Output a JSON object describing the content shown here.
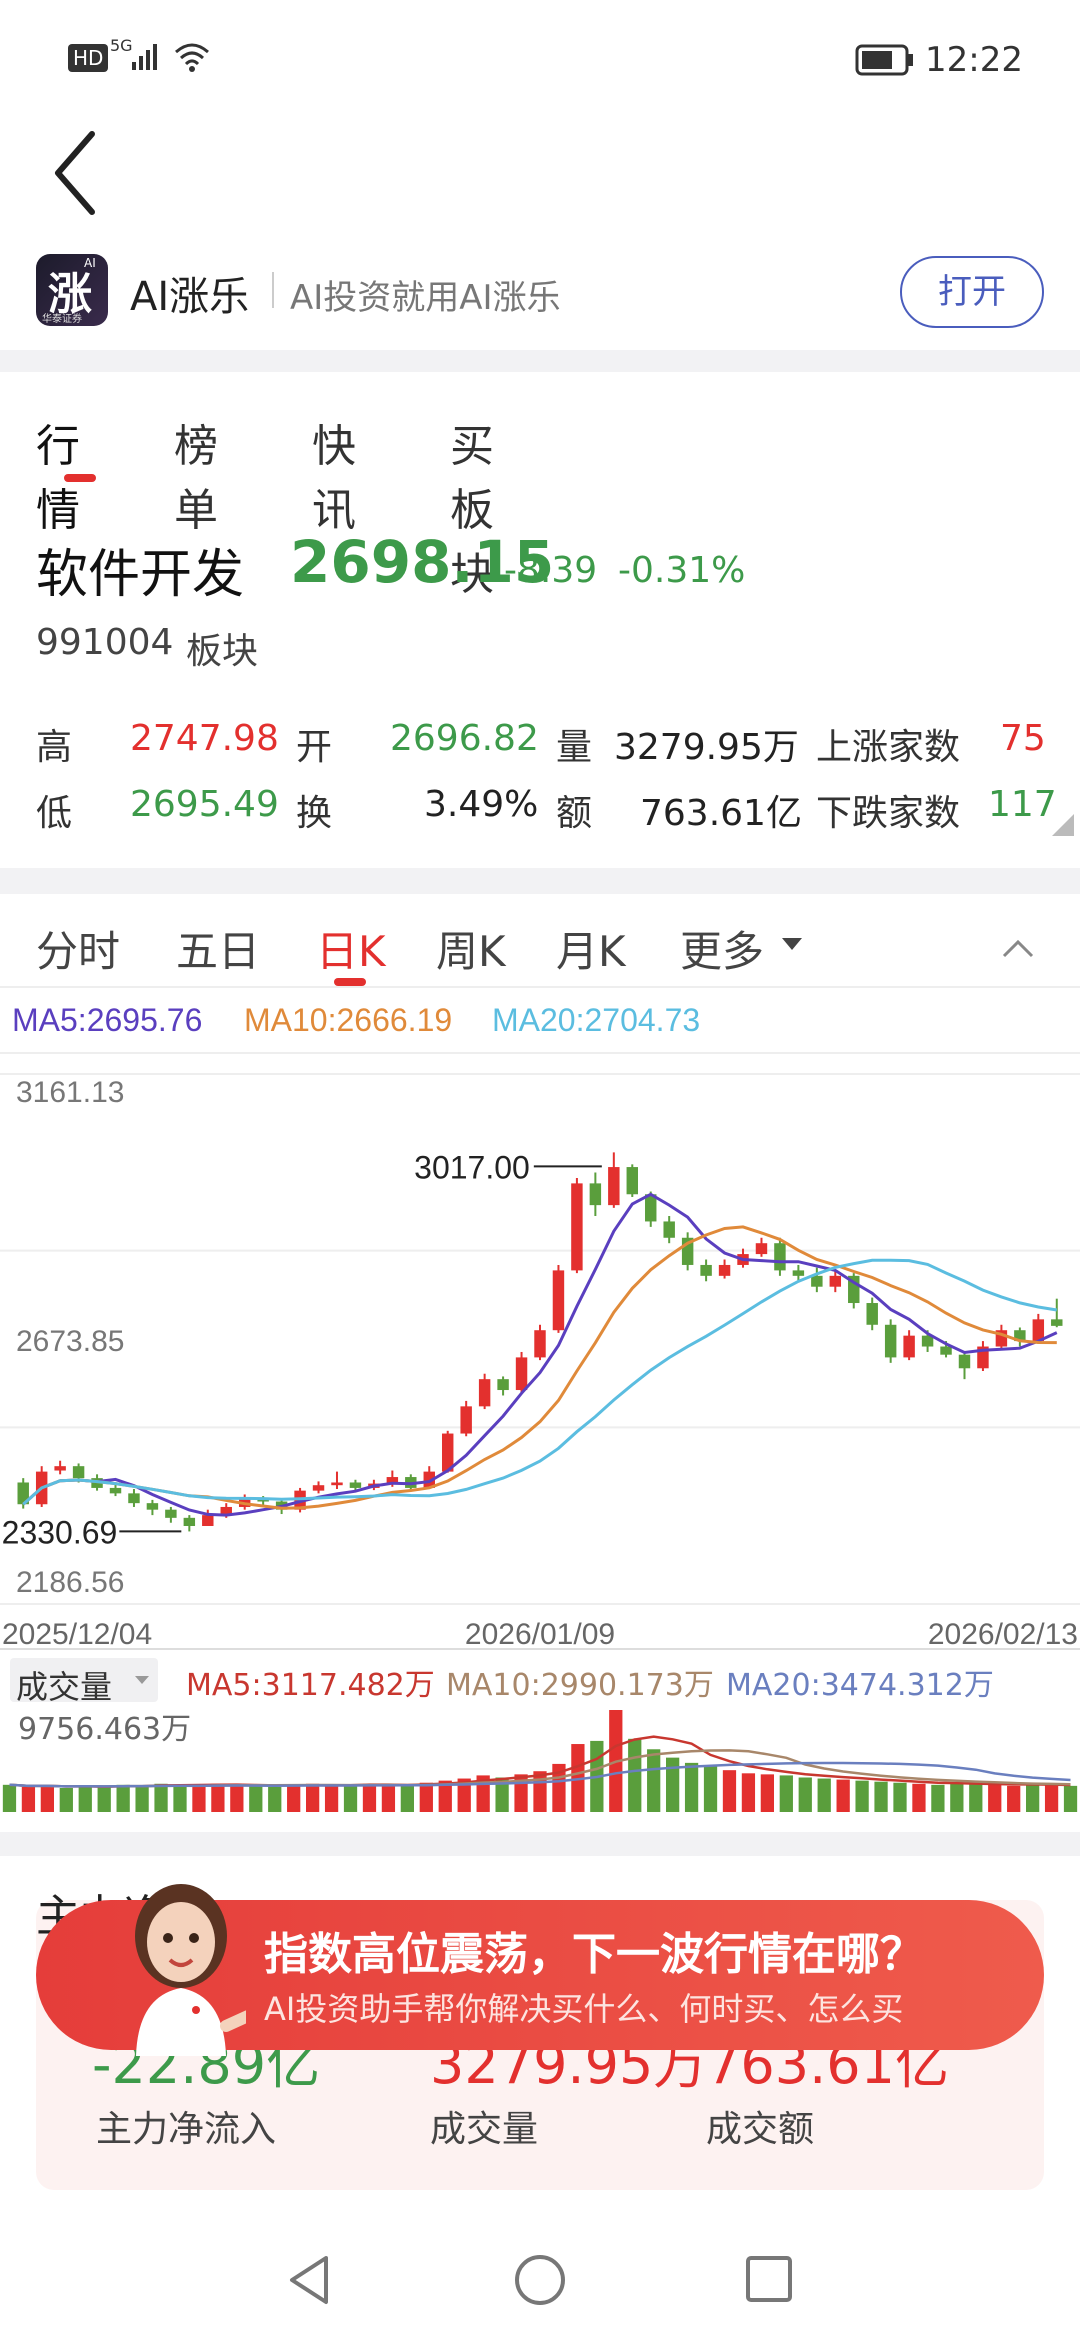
{
  "status": {
    "network_hd": "HD",
    "network_5g": "5G",
    "time": "12:22"
  },
  "app": {
    "name": "AI涨乐",
    "slogan": "AI投资就用AI涨乐",
    "open_button": "打开",
    "logo_text": "涨",
    "logo_sub": "华泰证券",
    "logo_badge": "AI"
  },
  "tabs": [
    "行情",
    "榜单",
    "快讯",
    "买板块"
  ],
  "stock": {
    "name": "软件开发",
    "price": "2698.15",
    "change": "-8.39",
    "change_pct": "-0.31%",
    "code": "991004",
    "type": "板块"
  },
  "kpis": {
    "high_label": "高",
    "high": "2747.98",
    "open_label": "开",
    "open": "2696.82",
    "vol_label": "量",
    "vol": "3279.95万",
    "up_label": "上涨家数",
    "up": "75",
    "low_label": "低",
    "low": "2695.49",
    "turn_label": "换",
    "turn": "3.49%",
    "amt_label": "额",
    "amt": "763.61亿",
    "down_label": "下跌家数",
    "down": "117"
  },
  "chart_tabs": [
    "分时",
    "五日",
    "日K",
    "周K",
    "月K",
    "更多"
  ],
  "ma": {
    "ma5": "MA5:2695.76",
    "ma10": "MA10:2666.19",
    "ma20": "MA20:2704.73"
  },
  "colors": {
    "up": "#e3302e",
    "down": "#5a9e3c",
    "ma5": "#5a3fbf",
    "ma10": "#e08a3a",
    "ma20": "#5bbde0",
    "accent": "#e3302e"
  },
  "chart_data": {
    "type": "candlestick",
    "y_labels": [
      "3161.13",
      "2673.85",
      "2186.56"
    ],
    "ylim": [
      2186.56,
      3161.13
    ],
    "max_annotation": "3017.00",
    "min_annotation": "2330.69",
    "x_labels": [
      "2025/12/04",
      "2026/01/09",
      "2026/02/13"
    ],
    "candles": [
      [
        2410,
        2370,
        2418,
        2362
      ],
      [
        2370,
        2430,
        2440,
        2365
      ],
      [
        2432,
        2440,
        2450,
        2425
      ],
      [
        2440,
        2418,
        2445,
        2410
      ],
      [
        2418,
        2400,
        2425,
        2395
      ],
      [
        2400,
        2390,
        2408,
        2385
      ],
      [
        2390,
        2372,
        2398,
        2365
      ],
      [
        2372,
        2360,
        2378,
        2350
      ],
      [
        2360,
        2345,
        2365,
        2336
      ],
      [
        2345,
        2330,
        2350,
        2320
      ],
      [
        2330,
        2350,
        2360,
        2330.69
      ],
      [
        2350,
        2365,
        2372,
        2345
      ],
      [
        2365,
        2380,
        2388,
        2360
      ],
      [
        2380,
        2375,
        2385,
        2368
      ],
      [
        2375,
        2360,
        2380,
        2352
      ],
      [
        2360,
        2395,
        2400,
        2355
      ],
      [
        2395,
        2405,
        2412,
        2390
      ],
      [
        2405,
        2410,
        2430,
        2398
      ],
      [
        2410,
        2400,
        2415,
        2392
      ],
      [
        2400,
        2408,
        2415,
        2396
      ],
      [
        2408,
        2420,
        2432,
        2402
      ],
      [
        2420,
        2400,
        2425,
        2395
      ],
      [
        2400,
        2430,
        2440,
        2398
      ],
      [
        2430,
        2500,
        2505,
        2428
      ],
      [
        2500,
        2550,
        2560,
        2495
      ],
      [
        2550,
        2600,
        2610,
        2545
      ],
      [
        2600,
        2580,
        2605,
        2570
      ],
      [
        2580,
        2640,
        2650,
        2575
      ],
      [
        2640,
        2690,
        2700,
        2635
      ],
      [
        2690,
        2800,
        2810,
        2685
      ],
      [
        2800,
        2960,
        2970,
        2795
      ],
      [
        2960,
        2920,
        2980,
        2900
      ],
      [
        2920,
        2990,
        3017,
        2915
      ],
      [
        2990,
        2940,
        2995,
        2935
      ],
      [
        2940,
        2890,
        2945,
        2880
      ],
      [
        2890,
        2860,
        2900,
        2850
      ],
      [
        2860,
        2810,
        2870,
        2800
      ],
      [
        2810,
        2790,
        2820,
        2780
      ],
      [
        2790,
        2810,
        2820,
        2785
      ],
      [
        2810,
        2830,
        2840,
        2805
      ],
      [
        2830,
        2850,
        2860,
        2825
      ],
      [
        2850,
        2800,
        2860,
        2790
      ],
      [
        2800,
        2790,
        2810,
        2780
      ],
      [
        2790,
        2770,
        2805,
        2760
      ],
      [
        2770,
        2790,
        2800,
        2760
      ],
      [
        2790,
        2740,
        2795,
        2730
      ],
      [
        2740,
        2700,
        2750,
        2690
      ],
      [
        2700,
        2640,
        2710,
        2630
      ],
      [
        2640,
        2680,
        2690,
        2635
      ],
      [
        2680,
        2660,
        2690,
        2650
      ],
      [
        2660,
        2645,
        2670,
        2640
      ],
      [
        2645,
        2620,
        2650,
        2600
      ],
      [
        2620,
        2660,
        2670,
        2615
      ],
      [
        2660,
        2690,
        2700,
        2655
      ],
      [
        2690,
        2670,
        2695,
        2660
      ],
      [
        2670,
        2710,
        2720,
        2665
      ],
      [
        2710,
        2698,
        2747.98,
        2695.49
      ]
    ],
    "volume": {
      "label": "成交量",
      "ma5": "MA5:3117.482万",
      "ma10": "MA10:2990.173万",
      "ma20": "MA20:3474.312万",
      "max_label": "9756.463万",
      "values": [
        2600,
        2400,
        2500,
        2300,
        2500,
        2400,
        2600,
        2500,
        2700,
        2600,
        2500,
        2700,
        2600,
        2500,
        2400,
        2600,
        2700,
        2500,
        2600,
        2700,
        2600,
        2500,
        2800,
        3000,
        3200,
        3500,
        3300,
        3600,
        3900,
        4600,
        6500,
        6800,
        9756,
        7000,
        6000,
        5200,
        4700,
        4400,
        4000,
        3700,
        3600,
        3500,
        3300,
        3200,
        3100,
        3000,
        2900,
        2800,
        2700,
        2600,
        2800,
        2700,
        2600,
        2500,
        2600,
        2700,
        2500
      ]
    }
  },
  "flow": {
    "title": "主力净流",
    "net": "-22.89亿",
    "net_label": "主力净流入",
    "vol": "3279.95万",
    "vol_label": "成交量",
    "amt": "763.61亿",
    "amt_label": "成交额"
  },
  "banner": {
    "title": "指数高位震荡，下一波行情在哪？",
    "subtitle": "AI投资助手帮你解决买什么、何时买、怎么买"
  }
}
